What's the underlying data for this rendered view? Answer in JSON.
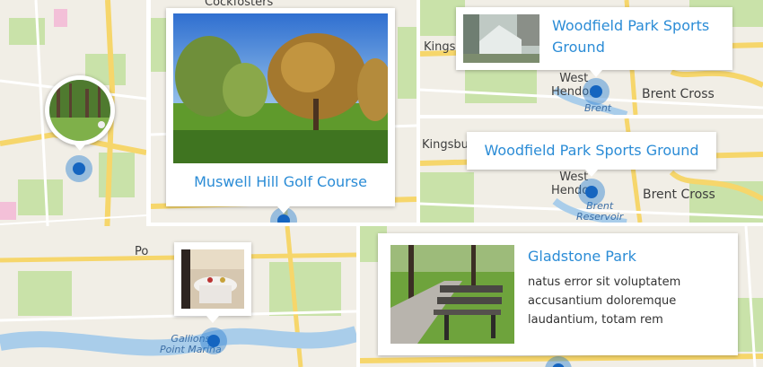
{
  "map_labels": {
    "cockfosters": "Cockfosters",
    "kingsbury_top": "Kingsb",
    "west_hendon_top": "West\nHendon",
    "brent_cross_top": "Brent Cross",
    "brent_top": "Brent",
    "kingsbury_mid": "Kingsbu",
    "west_hendon_mid": "West\nHendon",
    "brent_cross_mid": "Brent Cross",
    "brent_reservoir": "Brent\nReservoir",
    "po": "Po",
    "gallions": "Gallions\nPoint Marina"
  },
  "cards": {
    "muswell": {
      "title": "Muswell Hill Golf Course"
    },
    "woodfield_top": {
      "title": "Woodfield Park Sports\nGround"
    },
    "woodfield_mid": {
      "title": "Woodfield Park Sports Ground"
    },
    "gladstone": {
      "title": "Gladstone Park",
      "description": "natus error sit voluptatem\naccusantium doloremque\nlaudantium, totam rem"
    }
  },
  "colors": {
    "link_blue": "#2b8cd6",
    "pin_blue": "#1565c0",
    "map_bg": "#f1eee6",
    "road_yellow": "#f6d66b",
    "park_green": "#c9e2a9",
    "water_blue": "#a9cdea"
  }
}
